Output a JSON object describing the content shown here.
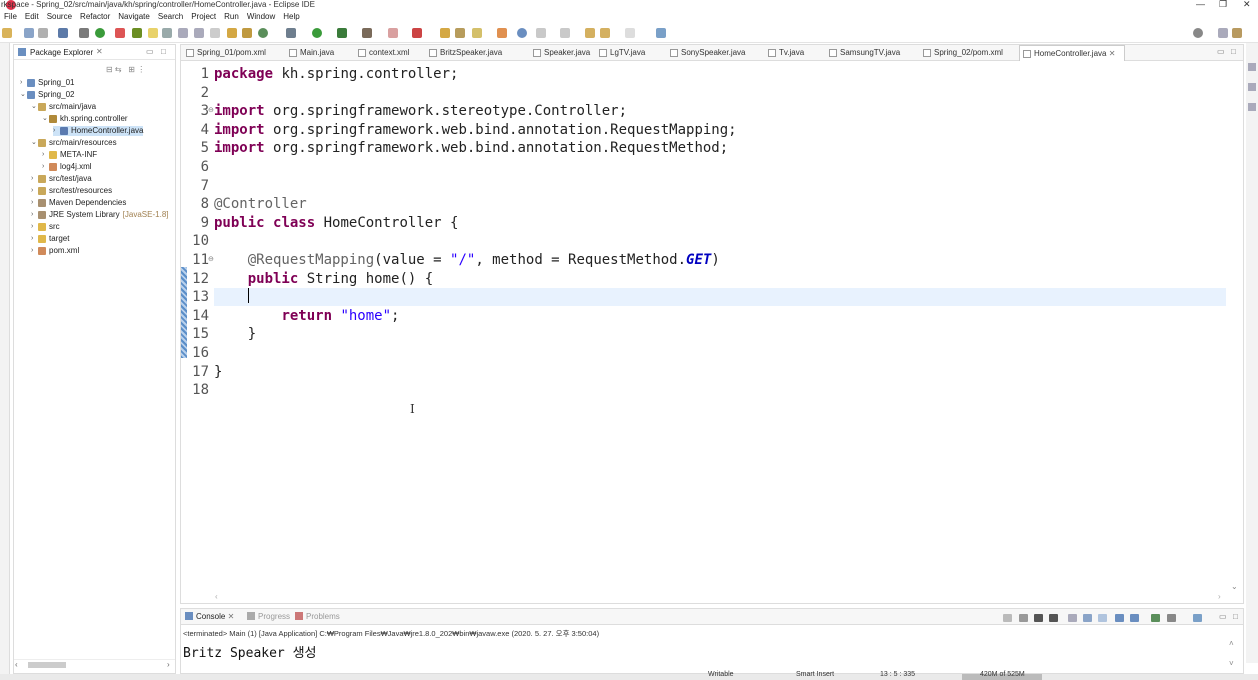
{
  "window": {
    "title": "rkspace - Spring_02/src/main/java/kh/spring/controller/HomeController.java - Eclipse IDE"
  },
  "menu": [
    "File",
    "Edit",
    "Source",
    "Refactor",
    "Navigate",
    "Search",
    "Project",
    "Run",
    "Window",
    "Help"
  ],
  "package_explorer": {
    "title": "Package Explorer",
    "items": [
      {
        "label": "Spring_01",
        "icon": "project-icon",
        "depth": 0,
        "expanded": false
      },
      {
        "label": "Spring_02",
        "icon": "project-icon",
        "depth": 0,
        "expanded": true
      },
      {
        "label": "src/main/java",
        "icon": "source-folder-icon",
        "depth": 1,
        "expanded": true
      },
      {
        "label": "kh.spring.controller",
        "icon": "package-icon",
        "depth": 2,
        "expanded": true
      },
      {
        "label": "HomeController.java",
        "icon": "java-file-icon",
        "depth": 3,
        "expanded": false,
        "selected": true
      },
      {
        "label": "src/main/resources",
        "icon": "source-folder-icon",
        "depth": 1,
        "expanded": true
      },
      {
        "label": "META-INF",
        "icon": "folder-icon",
        "depth": 2,
        "expanded": false
      },
      {
        "label": "log4j.xml",
        "icon": "xml-file-icon",
        "depth": 2,
        "expanded": false
      },
      {
        "label": "src/test/java",
        "icon": "source-folder-icon",
        "depth": 1,
        "expanded": false
      },
      {
        "label": "src/test/resources",
        "icon": "source-folder-icon",
        "depth": 1,
        "expanded": false
      },
      {
        "label": "Maven Dependencies",
        "icon": "library-icon",
        "depth": 1,
        "expanded": false
      },
      {
        "label": "JRE System Library",
        "icon": "library-icon",
        "depth": 1,
        "expanded": false,
        "suffix": "[JavaSE-1.8]"
      },
      {
        "label": "src",
        "icon": "folder-icon",
        "depth": 1,
        "expanded": false
      },
      {
        "label": "target",
        "icon": "folder-icon",
        "depth": 1,
        "expanded": false
      },
      {
        "label": "pom.xml",
        "icon": "xml-file-icon",
        "depth": 1,
        "expanded": false
      }
    ]
  },
  "editor_tabs": [
    {
      "label": "Spring_01/pom.xml",
      "active": false
    },
    {
      "label": "Main.java",
      "active": false
    },
    {
      "label": "context.xml",
      "active": false
    },
    {
      "label": "BritzSpeaker.java",
      "active": false
    },
    {
      "label": "Speaker.java",
      "active": false
    },
    {
      "label": "LgTV.java",
      "active": false
    },
    {
      "label": "SonySpeaker.java",
      "active": false
    },
    {
      "label": "Tv.java",
      "active": false
    },
    {
      "label": "SamsungTV.java",
      "active": false
    },
    {
      "label": "Spring_02/pom.xml",
      "active": false
    },
    {
      "label": "HomeController.java",
      "active": true
    }
  ],
  "code": {
    "current_line": 13,
    "lines": [
      {
        "n": "1",
        "tokens": [
          {
            "t": "package",
            "c": "kw"
          },
          {
            "t": " kh.spring.controller;",
            "c": ""
          }
        ]
      },
      {
        "n": "2",
        "tokens": []
      },
      {
        "n": "3",
        "fold": true,
        "tokens": [
          {
            "t": "import",
            "c": "kw"
          },
          {
            "t": " org.springframework.stereotype.Controller;",
            "c": ""
          }
        ]
      },
      {
        "n": "4",
        "tokens": [
          {
            "t": "import",
            "c": "kw"
          },
          {
            "t": " org.springframework.web.bind.annotation.RequestMapping;",
            "c": ""
          }
        ]
      },
      {
        "n": "5",
        "tokens": [
          {
            "t": "import",
            "c": "kw"
          },
          {
            "t": " org.springframework.web.bind.annotation.RequestMethod;",
            "c": ""
          }
        ]
      },
      {
        "n": "6",
        "tokens": []
      },
      {
        "n": "7",
        "tokens": []
      },
      {
        "n": "8",
        "tokens": [
          {
            "t": "@Controller",
            "c": "ann"
          }
        ]
      },
      {
        "n": "9",
        "tokens": [
          {
            "t": "public",
            "c": "kw"
          },
          {
            "t": " ",
            "c": ""
          },
          {
            "t": "class",
            "c": "kw"
          },
          {
            "t": " HomeController {",
            "c": ""
          }
        ]
      },
      {
        "n": "10",
        "tokens": []
      },
      {
        "n": "11",
        "fold": true,
        "tokens": [
          {
            "t": "    ",
            "c": ""
          },
          {
            "t": "@RequestMapping",
            "c": "ann"
          },
          {
            "t": "(value = ",
            "c": ""
          },
          {
            "t": "\"/\"",
            "c": "str"
          },
          {
            "t": ", method = RequestMethod.",
            "c": ""
          },
          {
            "t": "GET",
            "c": "cst"
          },
          {
            "t": ")",
            "c": ""
          }
        ]
      },
      {
        "n": "12",
        "tokens": [
          {
            "t": "    ",
            "c": ""
          },
          {
            "t": "public",
            "c": "kw"
          },
          {
            "t": " String home() {",
            "c": ""
          }
        ]
      },
      {
        "n": "13",
        "tokens": [
          {
            "t": "    ",
            "c": ""
          }
        ]
      },
      {
        "n": "14",
        "tokens": [
          {
            "t": "        ",
            "c": ""
          },
          {
            "t": "return",
            "c": "kw"
          },
          {
            "t": " ",
            "c": ""
          },
          {
            "t": "\"home\"",
            "c": "str"
          },
          {
            "t": ";",
            "c": ""
          }
        ]
      },
      {
        "n": "15",
        "tokens": [
          {
            "t": "    }",
            "c": ""
          }
        ]
      },
      {
        "n": "16",
        "tokens": []
      },
      {
        "n": "17",
        "tokens": [
          {
            "t": "}",
            "c": ""
          }
        ]
      },
      {
        "n": "18",
        "tokens": []
      }
    ]
  },
  "console": {
    "tabs": [
      {
        "label": "Console",
        "active": true
      },
      {
        "label": "Progress",
        "active": false
      },
      {
        "label": "Problems",
        "active": false
      }
    ],
    "terminated_line": "<terminated> Main (1) [Java Application] C:₩Program Files₩Java₩jre1.8.0_202₩bin₩javaw.exe (2020. 5. 27. 오후 3:50:04)",
    "output": "Britz Speaker 생성"
  },
  "status": {
    "writable": "Writable",
    "insert_mode": "Smart Insert",
    "position": "13 : 5 : 335",
    "memory": "420M of 525M"
  }
}
